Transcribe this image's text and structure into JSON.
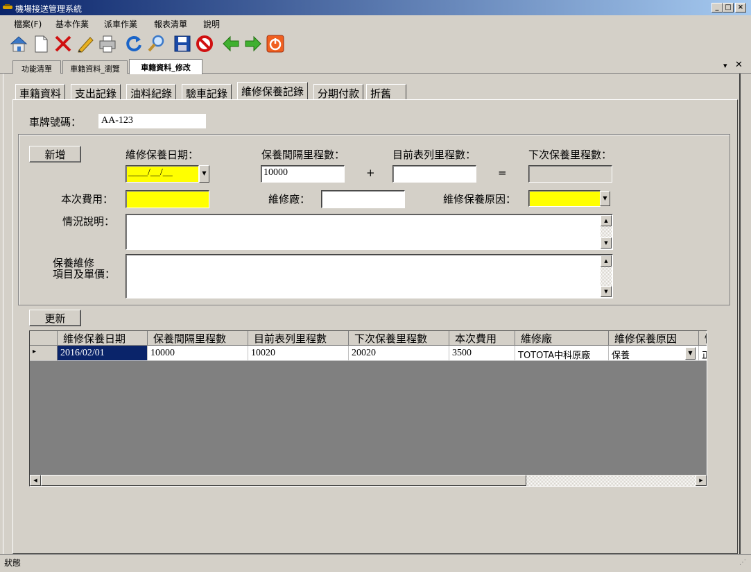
{
  "window": {
    "title": "機場接送管理系統"
  },
  "menu": {
    "items": [
      "檔案(F)",
      "基本作業",
      "派車作業",
      "報表清單",
      "說明"
    ]
  },
  "toolbar": {
    "icons": [
      "home-icon",
      "new-document-icon",
      "delete-icon",
      "edit-icon",
      "print-icon",
      "refresh-icon",
      "search-icon",
      "save-icon",
      "cancel-icon",
      "back-icon",
      "forward-icon",
      "power-icon"
    ]
  },
  "form_tabs": {
    "items": [
      "功能清單",
      "車籍資料_瀏覽",
      "車籍資料_修改"
    ],
    "active": 2
  },
  "inner_tabs": {
    "items": [
      "車籍資料",
      "支出記錄",
      "油料紀錄",
      "驗車記錄",
      "維修保養記錄",
      "分期付款",
      "折舊"
    ],
    "active": 4
  },
  "plate": {
    "label": "車牌號碼：",
    "value": "AA-123"
  },
  "form": {
    "add_button": "新增",
    "date_label": "維修保養日期：",
    "date_value": "____/__/__",
    "interval_label": "保養間隔里程數：",
    "interval_value": "10000",
    "plus": "+",
    "current_label": "目前表列里程數：",
    "current_value": "",
    "equals": "=",
    "next_label": "下次保養里程數：",
    "next_value": "",
    "cost_label": "本次費用：",
    "cost_value": "",
    "shop_label": "維修廠：",
    "shop_value": "",
    "reason_label": "維修保養原因：",
    "reason_value": "",
    "desc_label": "情況說明：",
    "items_label_1": "保養維修",
    "items_label_2": "項目及單價："
  },
  "update_button": "更新",
  "table": {
    "columns": [
      "維修保養日期",
      "保養間隔里程數",
      "目前表列里程數",
      "下次保養里程數",
      "本次費用",
      "維修廠",
      "維修保養原因",
      "情"
    ],
    "rows": [
      [
        "2016/02/01",
        "10000",
        "10020",
        "20020",
        "3500",
        "TOTOTA中科原廠",
        "保養",
        "正"
      ]
    ]
  },
  "status": {
    "text": "狀態"
  }
}
